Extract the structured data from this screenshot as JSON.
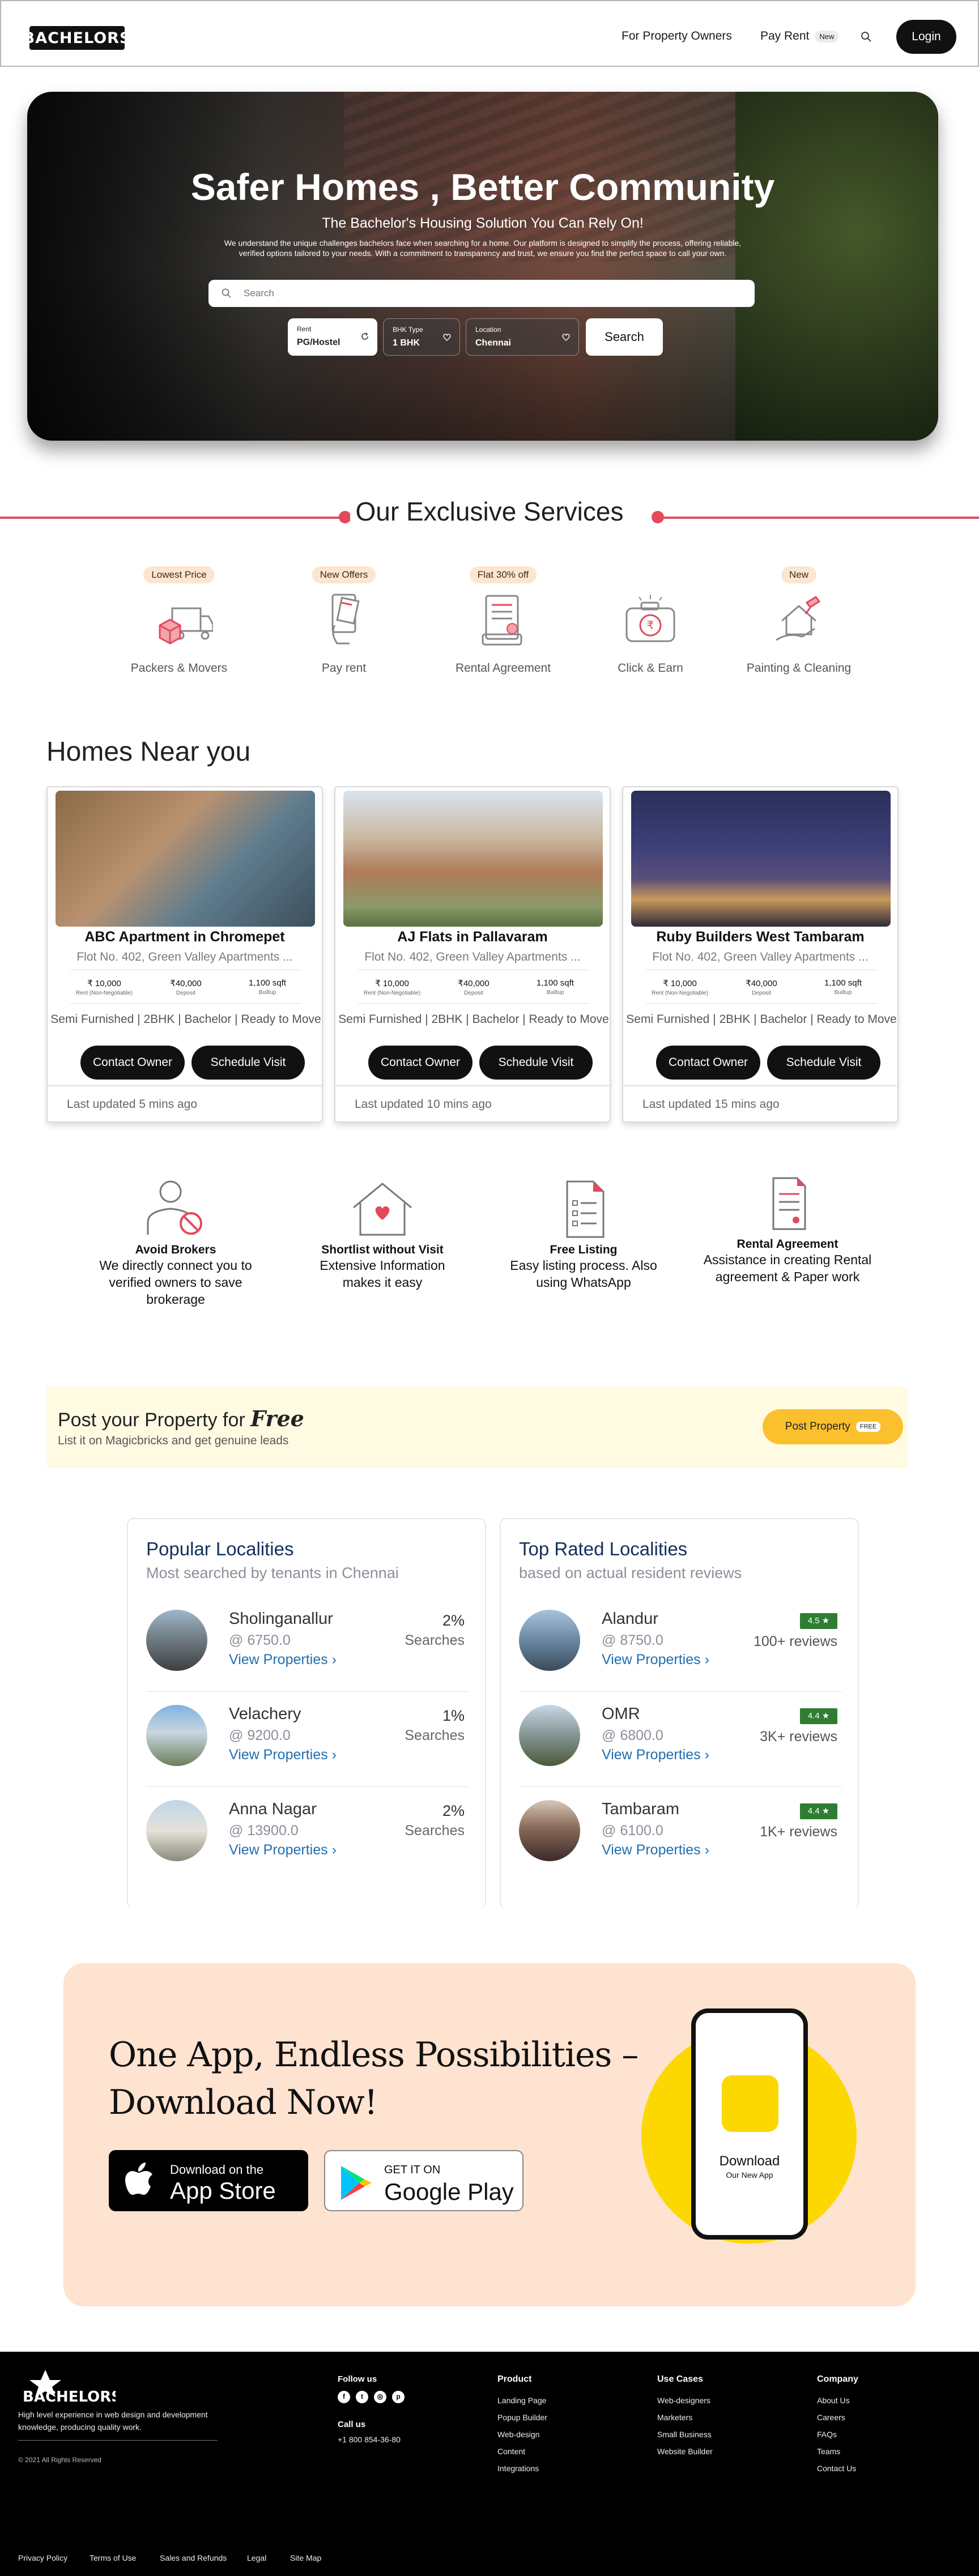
{
  "nav": {
    "logo": "BACHELORS",
    "owners": "For Property Owners",
    "pay_rent": "Pay Rent",
    "pay_rent_badge": "New",
    "login": "Login"
  },
  "hero": {
    "title": "Safer Homes , Better Community",
    "subtitle": "The Bachelor's Housing Solution You Can Rely On!",
    "description": "We understand the unique challenges bachelors face when searching for a home. Our platform is designed to simplify the process, offering reliable, verified options tailored to your needs. With a commitment to transparency and trust, we ensure you find the perfect space to call your own.",
    "search_placeholder": "Search",
    "filters": [
      {
        "label": "Rent",
        "value": "PG/Hostel"
      },
      {
        "label": "BHK Type",
        "value": "1 BHK"
      },
      {
        "label": "Location",
        "value": "Chennai"
      }
    ],
    "search_button": "Search"
  },
  "services": {
    "title": "Our Exclusive Services",
    "items": [
      {
        "tag": "Lowest Price",
        "name": "Packers & Movers",
        "icon": "truck-icon"
      },
      {
        "tag": "New Offers",
        "name": "Pay rent",
        "icon": "card-payment-icon"
      },
      {
        "tag": "Flat 30% off",
        "name": "Rental Agreement",
        "icon": "document-icon"
      },
      {
        "tag": "",
        "name": "Click & Earn",
        "icon": "camera-rupee-icon"
      },
      {
        "tag": "New",
        "name": "Painting & Cleaning",
        "icon": "paint-house-icon"
      }
    ]
  },
  "homes": {
    "title": "Homes Near you",
    "cards": [
      {
        "title": "ABC Apartment in Chromepet",
        "address": "Flot No. 402, Green Valley Apartments ...",
        "rent": "₹ 10,000",
        "rent_label": "Rent (Non-Negotiable)",
        "deposit": "₹40,000",
        "deposit_label": "Deposit",
        "area": "1,100 sqft",
        "area_label": "Builtup",
        "features": "Semi Furnished | 2BHK | Bachelor | Ready to Move",
        "contact": "Contact Owner",
        "visit": "Schedule Visit",
        "updated": "Last updated 5 mins ago"
      },
      {
        "title": "AJ Flats in Pallavaram",
        "address": "Flot No. 402, Green Valley Apartments ...",
        "rent": "₹ 10,000",
        "rent_label": "Rent (Non-Negotiable)",
        "deposit": "₹40,000",
        "deposit_label": "Deposit",
        "area": "1,100 sqft",
        "area_label": "Builtup",
        "features": "Semi Furnished | 2BHK | Bachelor | Ready to Move",
        "contact": "Contact Owner",
        "visit": "Schedule Visit",
        "updated": "Last updated 10 mins ago"
      },
      {
        "title": "Ruby Builders West Tambaram",
        "address": "Flot No. 402, Green Valley Apartments ...",
        "rent": "₹ 10,000",
        "rent_label": "Rent (Non-Negotiable)",
        "deposit": "₹40,000",
        "deposit_label": "Deposit",
        "area": "1,100 sqft",
        "area_label": "Builtup",
        "features": "Semi Furnished | 2BHK | Bachelor | Ready to Move",
        "contact": "Contact Owner",
        "visit": "Schedule Visit",
        "updated": "Last updated 15 mins ago"
      }
    ]
  },
  "features": [
    {
      "title": "Avoid Brokers",
      "desc": "We directly connect you to verified owners to save brokerage"
    },
    {
      "title": "Shortlist without Visit",
      "desc": "Extensive Information makes it easy"
    },
    {
      "title": "Free Listing",
      "desc": "Easy listing process. Also using WhatsApp"
    },
    {
      "title": "Rental Agreement",
      "desc": "Assistance in creating Rental agreement & Paper work"
    }
  ],
  "post": {
    "heading": "Post your Property for",
    "heading_em": "Free",
    "sub": "List it on Magicbricks and get genuine leads",
    "button": "Post Property",
    "button_badge": "FREE"
  },
  "popular": {
    "title": "Popular Localities",
    "subtitle": "Most searched by tenants in Chennai",
    "rows": [
      {
        "name": "Sholinganallur",
        "price": "@ 6750.0",
        "link": "View Properties",
        "pct": "2%",
        "label": "Searches"
      },
      {
        "name": "Velachery",
        "price": "@ 9200.0",
        "link": "View Properties",
        "pct": "1%",
        "label": "Searches"
      },
      {
        "name": "Anna Nagar",
        "price": "@ 13900.0",
        "link": "View Properties",
        "pct": "2%",
        "label": "Searches"
      }
    ]
  },
  "top_rated": {
    "title": "Top Rated Localities",
    "subtitle": "based on actual resident reviews",
    "rows": [
      {
        "name": "Alandur",
        "price": "@ 8750.0",
        "link": "View Properties",
        "rating": "4.5 ★",
        "reviews": "100+ reviews"
      },
      {
        "name": "OMR",
        "price": "@ 6800.0",
        "link": "View Properties",
        "rating": "4.4 ★",
        "reviews": "3K+ reviews"
      },
      {
        "name": "Tambaram",
        "price": "@ 6100.0",
        "link": "View Properties",
        "rating": "4.4 ★",
        "reviews": "1K+ reviews"
      }
    ]
  },
  "app": {
    "line1": "One App, Endless Possibilities –",
    "line2": "Download Now!",
    "apple_small": "Download on the",
    "apple_big": "App Store",
    "google_small": "GET IT ON",
    "google_big": "Google Play",
    "phone_title": "Download",
    "phone_sub": "Our New App"
  },
  "footer": {
    "logo": "BACHELORS",
    "desc": "High level experience in web design and development knowledge, producing quality work.",
    "copyright": "© 2021 All Rights Reserved",
    "follow": "Follow us",
    "call": "Call us",
    "phone": "+1 800 854-36-80",
    "product": {
      "title": "Product",
      "items": [
        "Landing Page",
        "Popup Builder",
        "Web-design",
        "Content",
        "Integrations"
      ]
    },
    "use_cases": {
      "title": "Use Cases",
      "items": [
        "Web-designers",
        "Marketers",
        "Small Business",
        "Website Builder"
      ]
    },
    "company": {
      "title": "Company",
      "items": [
        "About Us",
        "Careers",
        "FAQs",
        "Teams",
        "Contact Us"
      ]
    },
    "bottom": [
      "Privacy Policy",
      "Terms of Use",
      "Sales and Refunds",
      "Legal",
      "Site Map"
    ]
  },
  "colors": {
    "accent": "#e24a5b",
    "yellow": "#fbc02d",
    "dark": "#111111",
    "link": "#1f6fb2",
    "rating": "#2e7d32"
  }
}
